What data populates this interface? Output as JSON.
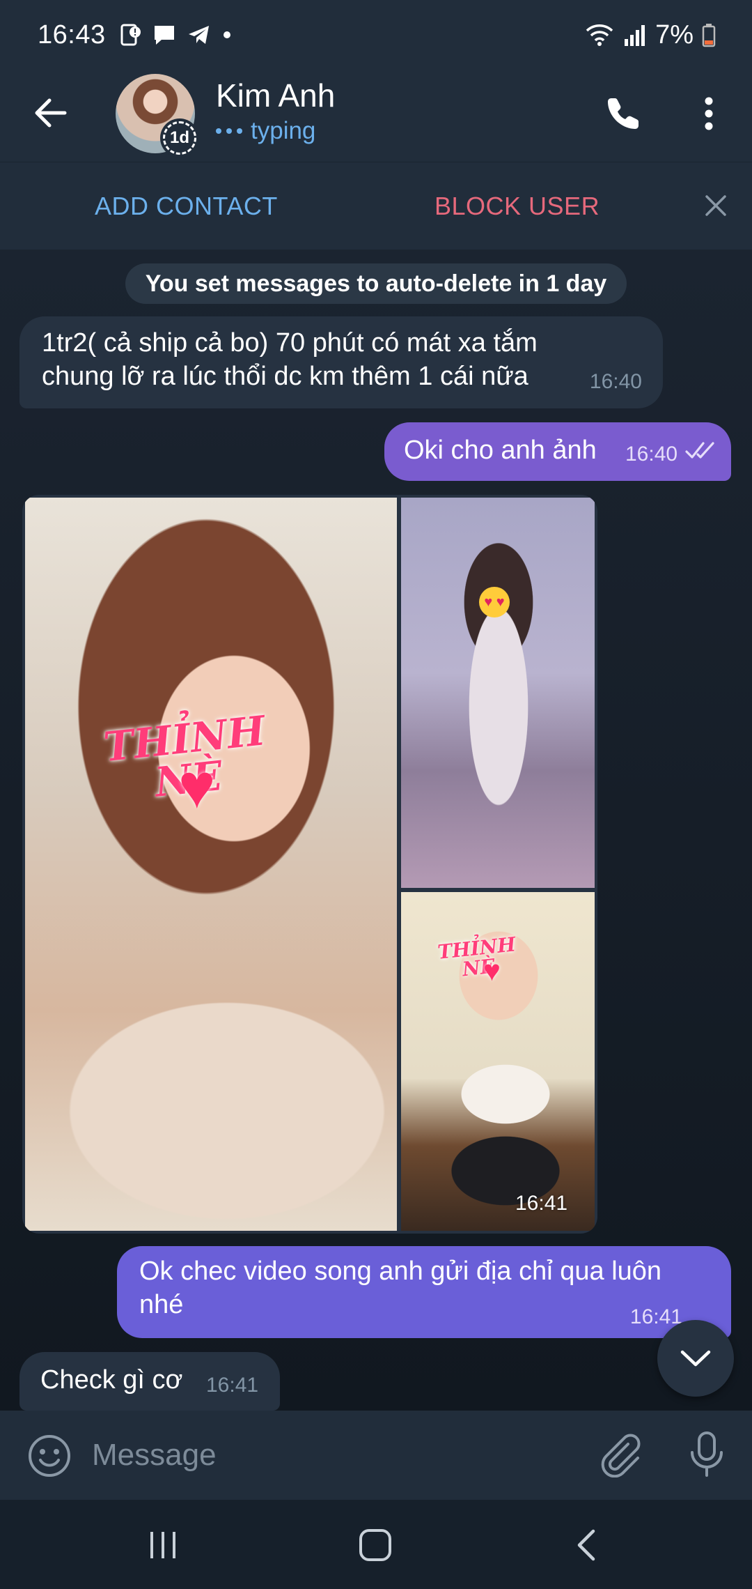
{
  "status_bar": {
    "time": "16:43",
    "battery": "7%",
    "notification_icons": [
      "sim-alert-icon",
      "chat-bubble-icon",
      "telegram-icon",
      "dot-icon"
    ],
    "system_icons": [
      "wifi-icon",
      "signal-icon",
      "battery-low-icon"
    ]
  },
  "header": {
    "contact_name": "Kim Anh",
    "status": "typing",
    "story_badge": "1d"
  },
  "action_bar": {
    "add_contact": "ADD CONTACT",
    "block_user": "BLOCK USER"
  },
  "chat": {
    "service_message": "You set messages to auto-delete in 1 day",
    "messages": [
      {
        "direction": "in",
        "text_line1": "1tr2( cả ship cả bo) 70 phút có mát xa tắm",
        "text_line2": "chung lỡ ra lúc thổi dc km thêm 1 cái nữa",
        "time": "16:40"
      },
      {
        "direction": "out",
        "text": "Oki cho anh ảnh",
        "time": "16:40",
        "read": true
      },
      {
        "direction": "in",
        "type": "album",
        "photo_count": 3,
        "sticker_main_line1": "THỈNH",
        "sticker_main_line2": "NÈ",
        "sticker_small_line1": "THỈNH",
        "sticker_small_line2": "NÈ",
        "time": "16:41"
      },
      {
        "direction": "out",
        "text_line1": "Ok chec video song anh gửi địa chỉ qua luôn",
        "text_line2": "nhé",
        "time": "16:41"
      },
      {
        "direction": "in",
        "text": "Check gì cơ",
        "time": "16:41"
      }
    ]
  },
  "input": {
    "placeholder": "Message",
    "value": ""
  },
  "colors": {
    "background": "#1d2733",
    "header": "#212d3b",
    "incoming_bubble": "#263241",
    "outgoing_bubble": "#7a5ccf",
    "accent_blue": "#6cb0ec",
    "danger_red": "#e6697c"
  }
}
